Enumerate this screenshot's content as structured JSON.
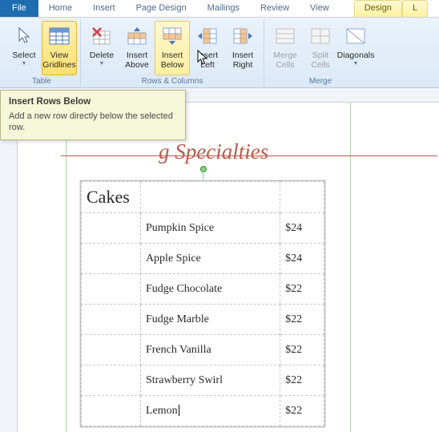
{
  "tabs": {
    "file": "File",
    "home": "Home",
    "insert": "Insert",
    "page_design": "Page Design",
    "mailings": "Mailings",
    "review": "Review",
    "view": "View",
    "design": "Design",
    "layout": "L"
  },
  "ribbon": {
    "groups": {
      "table": {
        "label": "Table",
        "select": "Select",
        "view_gridlines": "View\nGridlines"
      },
      "rows_columns": {
        "label": "Rows & Columns",
        "delete": "Delete",
        "insert_above": "Insert\nAbove",
        "insert_below": "Insert\nBelow",
        "insert_left": "Insert\nLeft",
        "insert_right": "Insert\nRight"
      },
      "merge": {
        "label": "Merge",
        "merge_cells": "Merge\nCells",
        "split_cells": "Split\nCells",
        "diagonals": "Diagonals"
      }
    }
  },
  "tooltip": {
    "title": "Insert Rows Below",
    "body": "Add a new row directly below the selected row."
  },
  "document": {
    "heading": "g Specialties",
    "table": {
      "header": "Cakes",
      "rows": [
        {
          "name": "Pumpkin Spice",
          "price": "$24"
        },
        {
          "name": "Apple Spice",
          "price": "$24"
        },
        {
          "name": "Fudge Chocolate",
          "price": "$22"
        },
        {
          "name": "Fudge Marble",
          "price": "$22"
        },
        {
          "name": "French Vanilla",
          "price": "$22"
        },
        {
          "name": "Strawberry Swirl",
          "price": "$22"
        },
        {
          "name": "Lemon",
          "price": "$22"
        }
      ]
    }
  }
}
